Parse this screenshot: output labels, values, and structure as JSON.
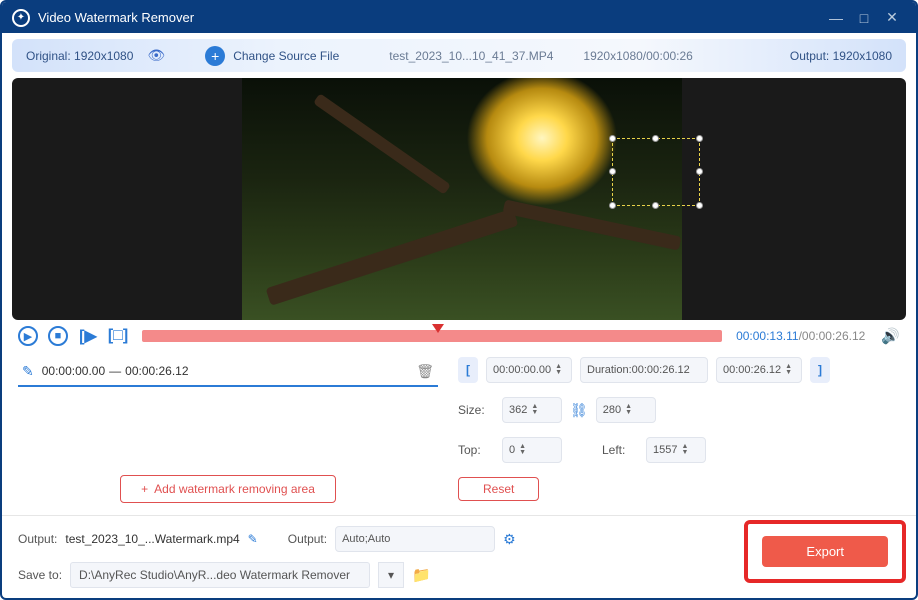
{
  "titlebar": {
    "title": "Video Watermark Remover"
  },
  "infobar": {
    "original": "Original: 1920x1080",
    "change": "Change Source File",
    "filename": "test_2023_10...10_41_37.MP4",
    "duration": "1920x1080/00:00:26",
    "output": "Output: 1920x1080"
  },
  "playback": {
    "current": "00:00:13.11",
    "total": "/00:00:26.12"
  },
  "segment": {
    "start": "00:00:00.00",
    "sep": "—",
    "end": "00:00:26.12"
  },
  "add_label": "Add watermark removing area",
  "range": {
    "start": "00:00:00.00",
    "dur_label": "Duration:",
    "dur": "00:00:26.12",
    "end": "00:00:26.12"
  },
  "size": {
    "label": "Size:",
    "w": "362",
    "h": "280"
  },
  "pos": {
    "top_label": "Top:",
    "top": "0",
    "left_label": "Left:",
    "left": "1557"
  },
  "reset": "Reset",
  "bottom": {
    "out_label": "Output:",
    "out_file": "test_2023_10_...Watermark.mp4",
    "fmt_label": "Output:",
    "fmt": "Auto;Auto",
    "save_label": "Save to:",
    "save_path": "D:\\AnyRec Studio\\AnyR...deo Watermark Remover"
  },
  "export": "Export"
}
